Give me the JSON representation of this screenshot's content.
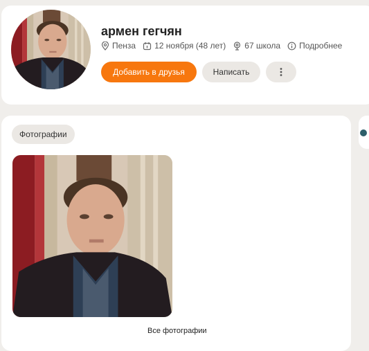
{
  "profile": {
    "name": "армен гегчян",
    "city": "Пенза",
    "birthday": "12 ноября (48 лет)",
    "school": "67 школа",
    "more": "Подробнее",
    "avatar_alt": "армен гегчян"
  },
  "actions": {
    "add_friend": "Добавить в друзья",
    "message": "Написать",
    "more_menu": "⋮"
  },
  "photos": {
    "tab_label": "Фотографии",
    "all_link": "Все фотографии"
  },
  "colors": {
    "accent": "#f7770e",
    "page_bg": "#f0eeeb",
    "chip_bg": "#ebe8e4"
  },
  "icons": {
    "location": "location-pin-icon",
    "birthday": "calendar-icon",
    "school": "graduation-cap-icon",
    "info": "info-icon",
    "more": "vertical-dots-icon"
  }
}
